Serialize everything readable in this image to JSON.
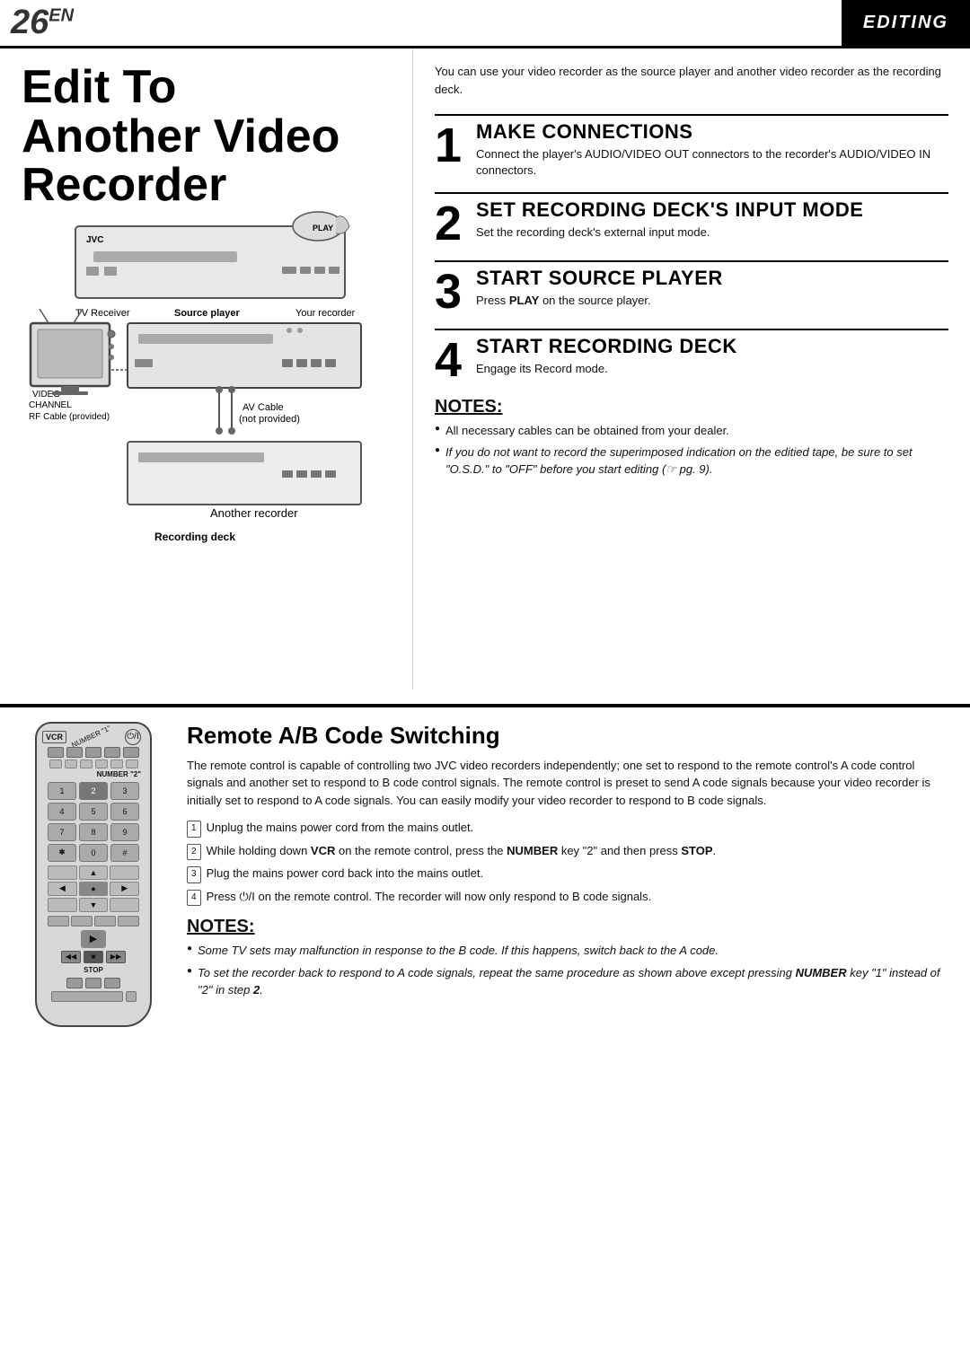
{
  "header": {
    "page_number": "26",
    "page_suffix": "EN",
    "section": "EDITING"
  },
  "page_title": {
    "line1": "Edit To",
    "line2": "Another Video",
    "line3": "Recorder"
  },
  "intro": {
    "text": "You can use your video recorder as the source player and another video recorder as the recording deck."
  },
  "steps": [
    {
      "number": "1",
      "title": "MAKE CONNECTIONS",
      "description": "Connect the player's AUDIO/VIDEO OUT connectors to the recorder's AUDIO/VIDEO IN connectors."
    },
    {
      "number": "2",
      "title": "SET RECORDING DECK'S INPUT MODE",
      "description": "Set the recording deck's external input mode."
    },
    {
      "number": "3",
      "title": "START SOURCE PLAYER",
      "description_prefix": "Press ",
      "description_bold": "PLAY",
      "description_suffix": " on the source player."
    },
    {
      "number": "4",
      "title": "START RECORDING DECK",
      "description": "Engage its Record mode."
    }
  ],
  "notes_top": {
    "title": "NOTES:",
    "items": [
      "All necessary cables can be obtained from your dealer.",
      "If you do not want to record the superimposed indication on the editied tape, be sure to set \"O.S.D.\" to \"OFF\" before you start editing (☞ pg. 9)."
    ]
  },
  "diagram": {
    "labels": {
      "tv_receiver": "TV Receiver",
      "source_player": "Source player",
      "your_recorder": "Your recorder",
      "av_cable": "AV Cable",
      "not_provided": "(not provided)",
      "rf_cable": "RF Cable (provided)",
      "another_recorder": "Another recorder",
      "recording_deck": "Recording deck",
      "jvc": "JVC"
    }
  },
  "remote_section": {
    "title": "Remote A/B Code Switching",
    "intro": "The remote control is capable of controlling two JVC video recorders independently; one set to respond to the remote control's A code control signals and another set to respond to B code control signals. The remote control is preset to send A code signals because your video recorder is initially set to respond to A code signals. You can easily modify your video recorder to respond to B code signals.",
    "steps": [
      {
        "num": "1",
        "text": "Unplug the mains power cord from the mains outlet."
      },
      {
        "num": "2",
        "text_prefix": "While holding down ",
        "text_bold": "VCR",
        "text_mid": " on the remote control, press the ",
        "text_bold2": "NUMBER",
        "text_suffix": " key \"2\" and then press ",
        "text_bold3": "STOP",
        "text_end": "."
      },
      {
        "num": "3",
        "text": "Plug the mains power cord back into the mains outlet."
      },
      {
        "num": "4",
        "text_prefix": "Press ⏻/I on the remote control. The recorder will now only respond to B code signals."
      }
    ],
    "notes": {
      "title": "NOTES:",
      "items": [
        "Some TV sets may malfunction in response to the B code. If this happens, switch back to the A code.",
        "To set the recorder back to respond to A code signals, repeat the same procedure as shown above except pressing NUMBER key \"1\" instead of \"2\" in step 2."
      ]
    },
    "remote_labels": {
      "vcr": "VCR",
      "number2": "NUMBER \"2\"",
      "number1": "NUMBER \"1\"",
      "stop": "STOP"
    }
  }
}
